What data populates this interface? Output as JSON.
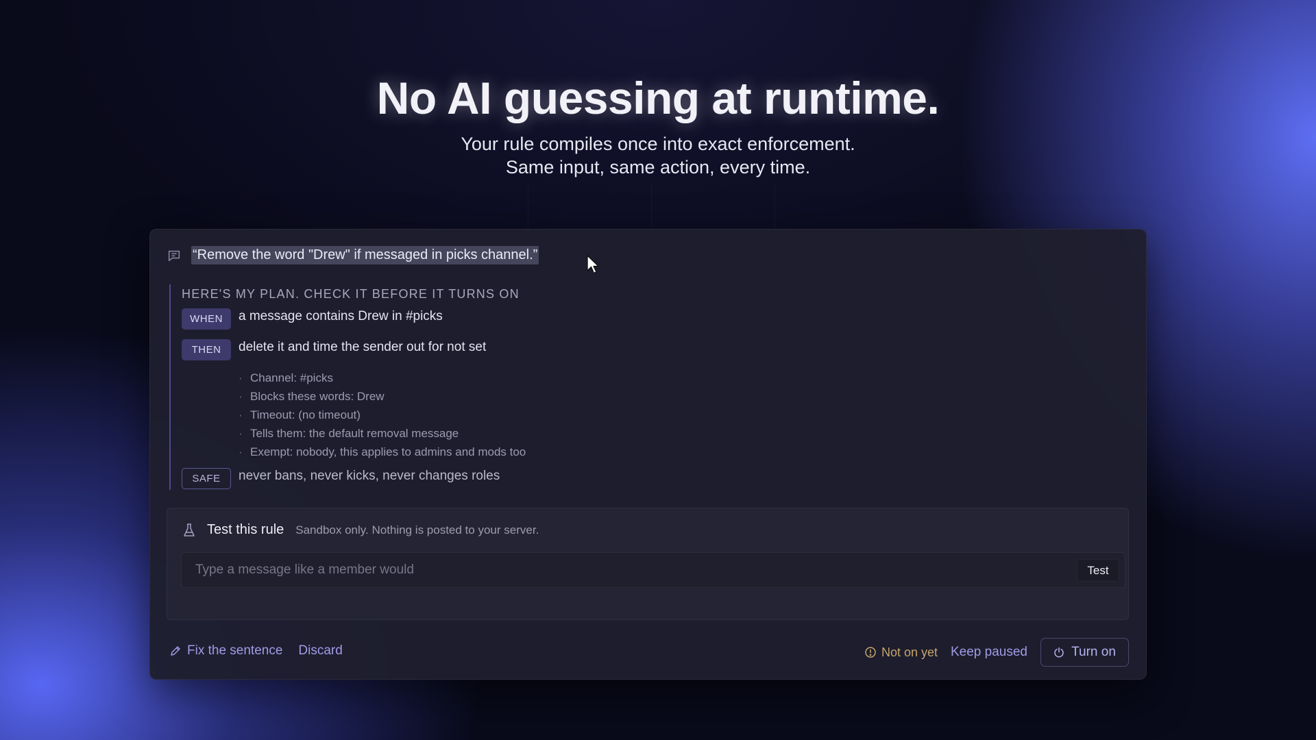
{
  "hero": {
    "title": "No AI guessing at runtime.",
    "subtitle_line1": "Your rule compiles once into exact enforcement.",
    "subtitle_line2": "Same input, same action, every time."
  },
  "prompt": {
    "icon": "chat-bubble-icon",
    "text": "“Remove the word \"Drew\" if messaged in picks channel.”"
  },
  "plan": {
    "heading": "HERE'S MY PLAN. CHECK IT BEFORE IT TURNS ON",
    "when": {
      "label": "WHEN",
      "text": "a message contains Drew in #picks"
    },
    "then": {
      "label": "THEN",
      "text": "delete it and time the sender out for not set"
    },
    "details": [
      "Channel: #picks",
      "Blocks these words: Drew",
      "Timeout: (no timeout)",
      "Tells them: the default removal message",
      "Exempt: nobody, this applies to admins and mods too"
    ],
    "safe": {
      "label": "SAFE",
      "text": "never bans, never kicks, never changes roles"
    }
  },
  "test": {
    "icon": "flask-icon",
    "title": "Test this rule",
    "note": "Sandbox only. Nothing is posted to your server.",
    "input_value": "",
    "placeholder": "Type a message like a member would",
    "button_label": "Test"
  },
  "footer": {
    "fix_label": "Fix the sentence",
    "discard_label": "Discard",
    "status_text": "Not on yet",
    "keep_paused_label": "Keep paused",
    "turn_on_label": "Turn on"
  },
  "colors": {
    "accent_link": "#a29be6",
    "warning": "#c6a56b",
    "pill_bg": "#3e3a6c",
    "card_bg": "#1e1e2e"
  }
}
